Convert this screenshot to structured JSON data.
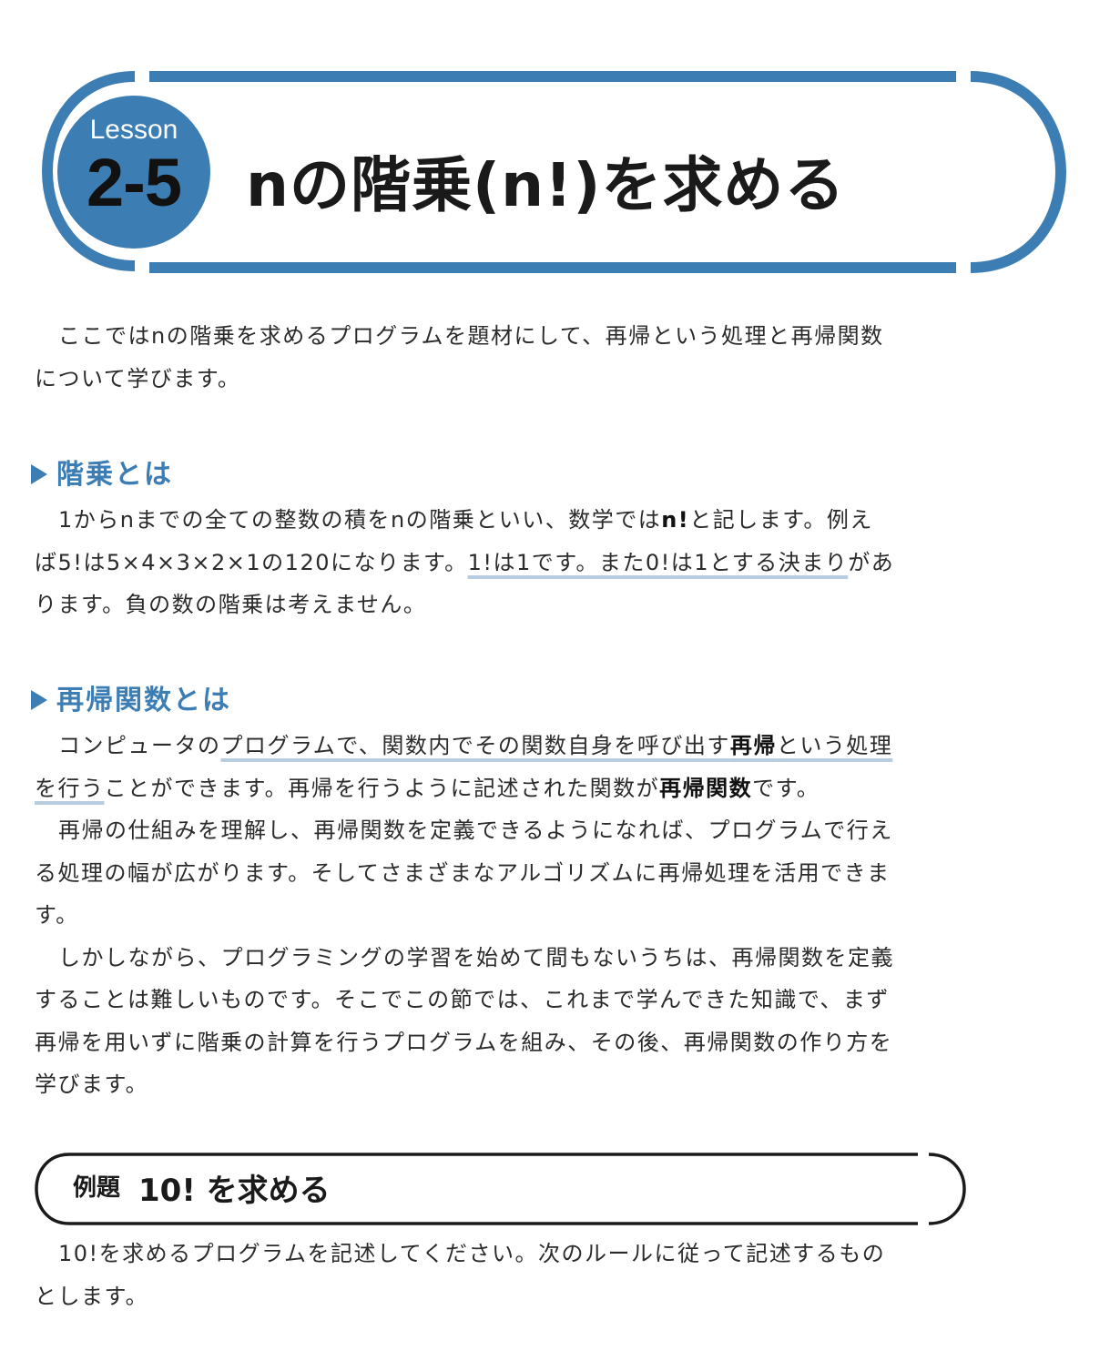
{
  "lesson": {
    "label": "Lesson",
    "number": "2-5",
    "title": "nの階乗(n!)を求める"
  },
  "intro": {
    "line1": "ここではnの階乗を求めるプログラムを題材にして、再帰という処理と再帰関数",
    "line2": "について学びます。"
  },
  "section_factorial": {
    "heading": "階乗とは",
    "l1_a": "1からnまでの全ての整数の積をnの階乗といい、数学では",
    "l1_b": "n!",
    "l1_c": "と記します。例え",
    "l2_a": "ば5!は5×4×3×2×1の120になります。",
    "l2_b": "1!は1です。また0!は1とする決まり",
    "l2_c": "があ",
    "l3": "ります。負の数の階乗は考えません。"
  },
  "section_recursion": {
    "heading": "再帰関数とは",
    "p1_l1_a": "コンピュータの",
    "p1_l1_b": "プログラムで、関数内でその関数自身を呼び出す",
    "p1_l1_c": "再帰",
    "p1_l1_d": "という処理",
    "p1_l2_a": "を行う",
    "p1_l2_b": "ことができます。再帰を行うように記述された関数が",
    "p1_l2_c": "再帰関数",
    "p1_l2_d": "です。",
    "p2_l1": "再帰の仕組みを理解し、再帰関数を定義できるようになれば、プログラムで行え",
    "p2_l2": "る処理の幅が広がります。そしてさまざまなアルゴリズムに再帰処理を活用できま",
    "p2_l3": "す。",
    "p3_l1": "しかしながら、プログラミングの学習を始めて間もないうちは、再帰関数を定義",
    "p3_l2": "することは難しいものです。そこでこの節では、これまで学んできた知識で、まず",
    "p3_l3": "再帰を用いずに階乗の計算を行うプログラムを組み、その後、再帰関数の作り方を",
    "p3_l4": "学びます。"
  },
  "example": {
    "label": "例題",
    "title": "10! を求める",
    "line1": "10!を求めるプログラムを記述してください。次のルールに従って記述するもの",
    "line2": "とします。"
  },
  "colors": {
    "accent": "#3c7eb4",
    "highlight_underline": "#b9cde0",
    "text": "#2b2b2b"
  }
}
